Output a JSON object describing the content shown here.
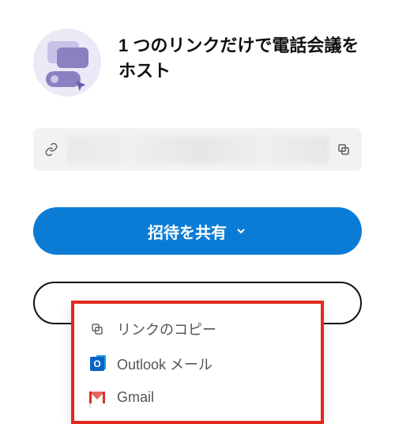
{
  "header": {
    "title": "1 つのリンクだけで電話会議をホスト"
  },
  "link_field": {
    "value_masked": true
  },
  "share_button": {
    "label": "招待を共有"
  },
  "menu": {
    "items": [
      {
        "label": "リンクのコピー"
      },
      {
        "label": "Outlook メール"
      },
      {
        "label": "Gmail"
      }
    ]
  }
}
